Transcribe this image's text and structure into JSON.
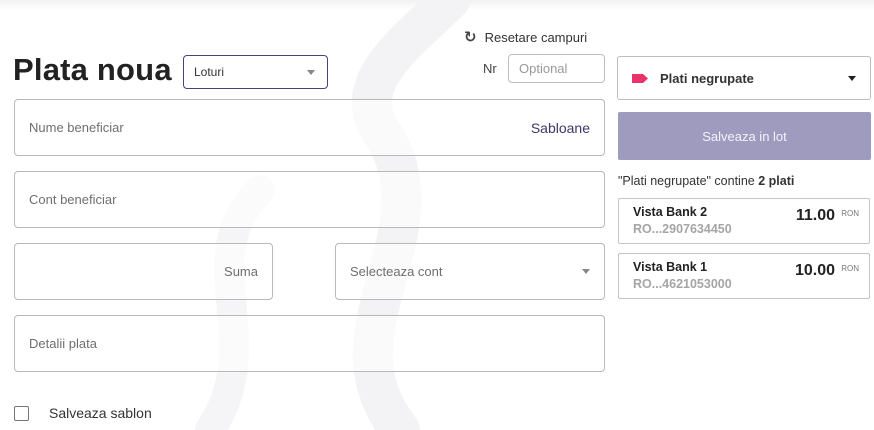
{
  "header": {
    "reset_label": "Resetare campuri",
    "title": "Plata noua",
    "batch_select_value": "Loturi",
    "nr_label": "Nr",
    "nr_placeholder": "Optional"
  },
  "form": {
    "beneficiary_name_label": "Nume beneficiar",
    "templates_link": "Sabloane",
    "beneficiary_account_label": "Cont beneficiar",
    "amount_label": "Suma",
    "select_account_label": "Selecteaza cont",
    "details_label": "Detalii plata",
    "save_template_label": "Salveaza sablon",
    "save_template_checked": false
  },
  "sidebar": {
    "group_select_value": "Plati negrupate",
    "group_tag_color": "#e8336b",
    "save_batch_label": "Salveaza in lot",
    "group_info_prefix": "\"Plati negrupate\" contine ",
    "group_info_count": "2 plati",
    "payments": [
      {
        "name": "Vista Bank 2",
        "iban": "RO...2907634450",
        "amount": "11.00",
        "currency": "RON"
      },
      {
        "name": "Vista Bank 1",
        "iban": "RO...4621053000",
        "amount": "10.00",
        "currency": "RON"
      }
    ]
  },
  "colors": {
    "accent": "#4a4378",
    "button_bg": "#9e9bbf",
    "link": "#3c3868"
  }
}
